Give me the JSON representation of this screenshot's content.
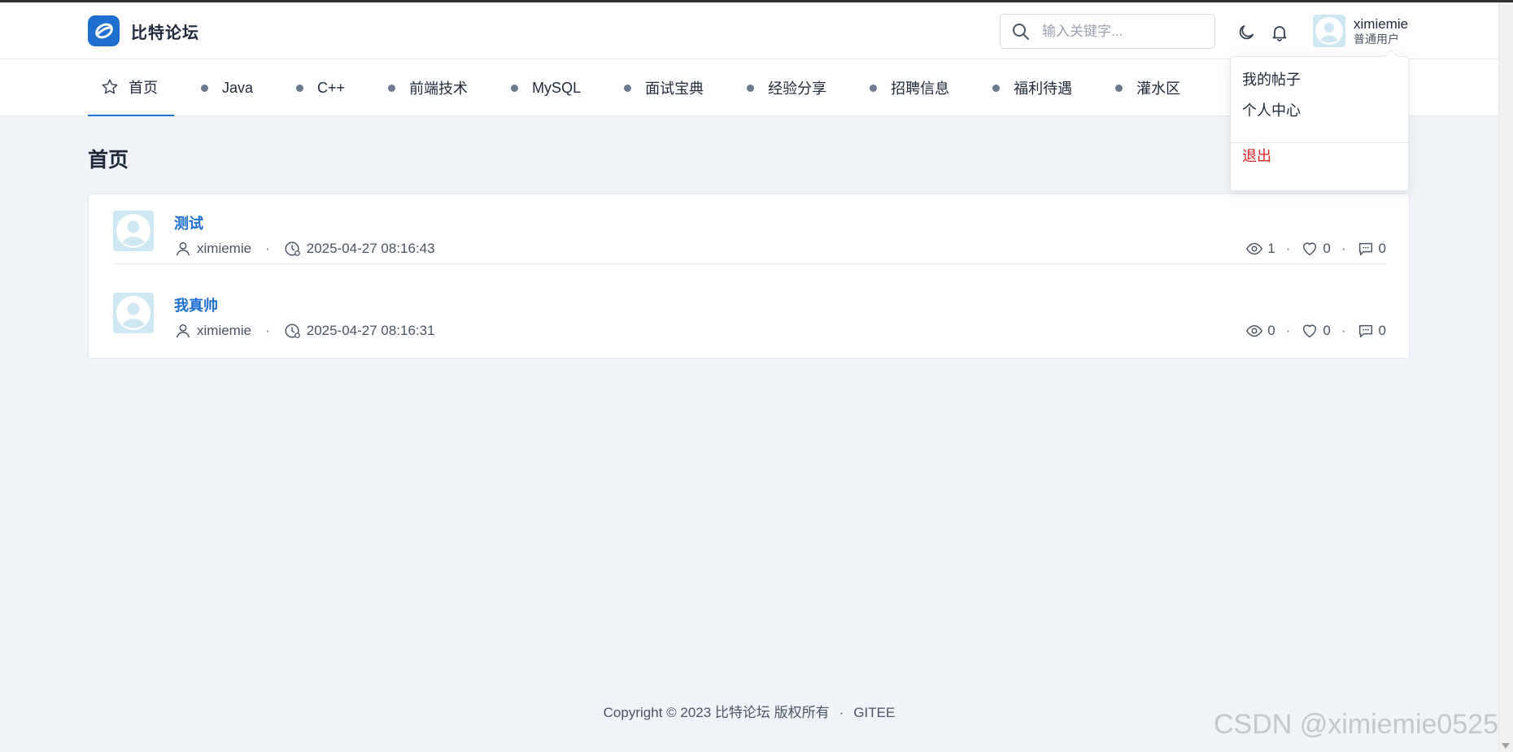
{
  "header": {
    "logo_text": "比特论坛",
    "search_placeholder": "输入关键字...",
    "user_name": "ximiemie",
    "user_role": "普通用户"
  },
  "nav": {
    "items": [
      {
        "label": "首页",
        "active": true
      },
      {
        "label": "Java"
      },
      {
        "label": "C++"
      },
      {
        "label": "前端技术"
      },
      {
        "label": "MySQL"
      },
      {
        "label": "面试宝典"
      },
      {
        "label": "经验分享"
      },
      {
        "label": "招聘信息"
      },
      {
        "label": "福利待遇"
      },
      {
        "label": "灌水区"
      }
    ]
  },
  "main": {
    "page_title": "首页",
    "posts": [
      {
        "title": "测试",
        "author": "ximiemie",
        "time": "2025-04-27 08:16:43",
        "views": "1",
        "likes": "0",
        "comments": "0"
      },
      {
        "title": "我真帅",
        "author": "ximiemie",
        "time": "2025-04-27 08:16:31",
        "views": "0",
        "likes": "0",
        "comments": "0"
      }
    ]
  },
  "dropdown": {
    "my_posts": "我的帖子",
    "profile": "个人中心",
    "logout": "退出"
  },
  "footer": {
    "copyright": "Copyright © 2023 比特论坛 版权所有",
    "separator": "·",
    "link": "GITEE"
  },
  "watermark": "CSDN @ximiemie0525",
  "colors": {
    "accent": "#1f6fd1",
    "danger": "#dc2626",
    "background": "#f0f3f8"
  }
}
